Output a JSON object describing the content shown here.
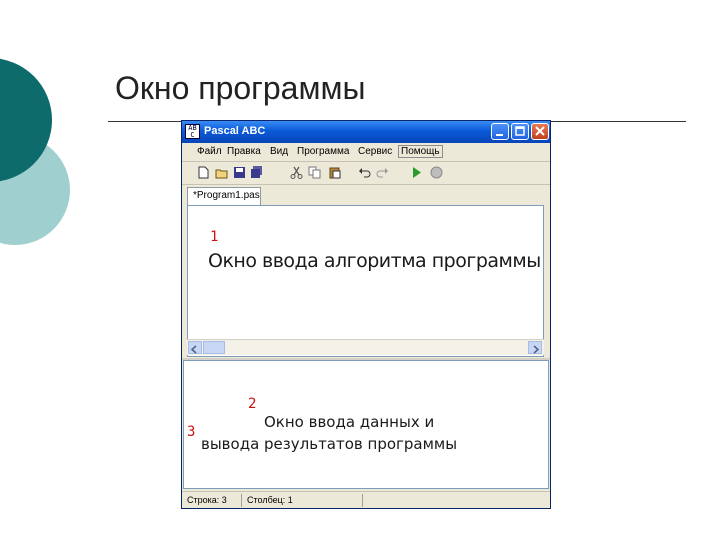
{
  "slide": {
    "title": "Окно программы",
    "colors": {
      "circle_dark": "#0d6b6b",
      "circle_light": "#9fd0cf"
    }
  },
  "window": {
    "title": "Pascal ABC",
    "icon_text": "AB C",
    "menu": [
      "Файл",
      "Правка",
      "Вид",
      "Программа",
      "Сервис",
      "Помощь"
    ],
    "toolbar_icons": [
      "new-file-icon",
      "open-file-icon",
      "save-icon",
      "save-all-icon",
      "cut-icon",
      "copy-icon",
      "paste-icon",
      "undo-icon",
      "redo-icon",
      "run-icon",
      "stop-icon"
    ],
    "tab": "*Program1.pas",
    "status": {
      "line": "Строка: 3",
      "column": "Столбец: 1"
    }
  },
  "annotations": {
    "editor_number": "1",
    "editor_label": "Окно ввода алгоритма программы",
    "output_number": "2",
    "output_label_line1": "Окно ввода данных и",
    "output_label_line2": "вывода результатов программы",
    "output_number2": "3"
  }
}
